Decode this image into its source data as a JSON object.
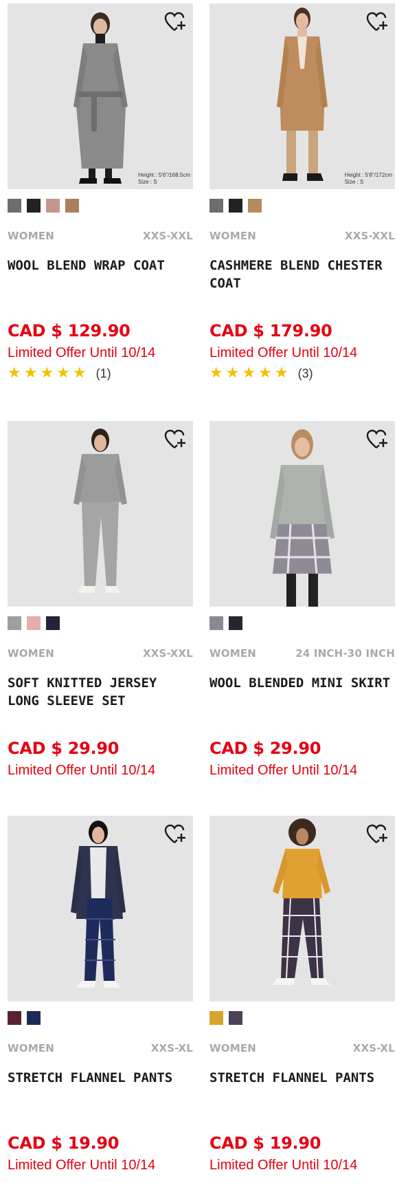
{
  "colors": {
    "price_red": "#e60012",
    "meta_gray": "#a9a9a9",
    "star_yellow": "#f2c200",
    "image_bg": "#e4e4e4"
  },
  "products": [
    {
      "image_icon": "woman-grey-wrap-coat-photo",
      "image_note_line1": "Height : 5'6\"/168.5cm",
      "image_note_line2": "Size : S",
      "swatches": [
        "#6d6d6d",
        "#222222",
        "#c4968c",
        "#a9805e"
      ],
      "gender": "WOMEN",
      "sizes": "XXS-XXL",
      "name": "WOOL BLEND WRAP COAT",
      "price": "CAD $ 129.90",
      "offer": "Limited Offer Until 10/14",
      "stars": "★★★★★",
      "rating_count": "(1)"
    },
    {
      "image_icon": "woman-camel-chester-coat-photo",
      "image_note_line1": "Height : 5'8\"/172cm",
      "image_note_line2": "Size : S",
      "swatches": [
        "#6d6d6d",
        "#222222",
        "#b58a5f"
      ],
      "gender": "WOMEN",
      "sizes": "XXS-XXL",
      "name": "CASHMERE BLEND CHESTER COAT",
      "price": "CAD $ 179.90",
      "offer": "Limited Offer Until 10/14",
      "stars": "★★★★★",
      "rating_count": "(3)"
    },
    {
      "image_icon": "woman-grey-knit-set-photo",
      "swatches": [
        "#9e9e9e",
        "#e5adad",
        "#23233a"
      ],
      "gender": "WOMEN",
      "sizes": "XXS-XXL",
      "name": "SOFT KNITTED JERSEY LONG SLEEVE SET",
      "price": "CAD $ 29.90",
      "offer": "Limited Offer Until 10/14"
    },
    {
      "image_icon": "woman-plaid-mini-skirt-photo",
      "swatches": [
        "#8c8a90",
        "#2a2330"
      ],
      "gender": "WOMEN",
      "sizes": "24 INCH-30 INCH",
      "name": "WOOL BLENDED MINI SKIRT",
      "price": "CAD $ 29.90",
      "offer": "Limited Offer Until 10/14"
    },
    {
      "image_icon": "woman-navy-flannel-pants-photo",
      "swatches": [
        "#5a2230",
        "#1f2b57"
      ],
      "gender": "WOMEN",
      "sizes": "XXS-XL",
      "name": "STRETCH FLANNEL PANTS",
      "price": "CAD $ 19.90",
      "offer": "Limited Offer Until 10/14"
    },
    {
      "image_icon": "woman-plaid-flannel-pants-photo",
      "swatches": [
        "#d9a330",
        "#4d4157"
      ],
      "gender": "WOMEN",
      "sizes": "XXS-XL",
      "name": "STRETCH FLANNEL PANTS",
      "price": "CAD $ 19.90",
      "offer": "Limited Offer Until 10/14"
    }
  ]
}
